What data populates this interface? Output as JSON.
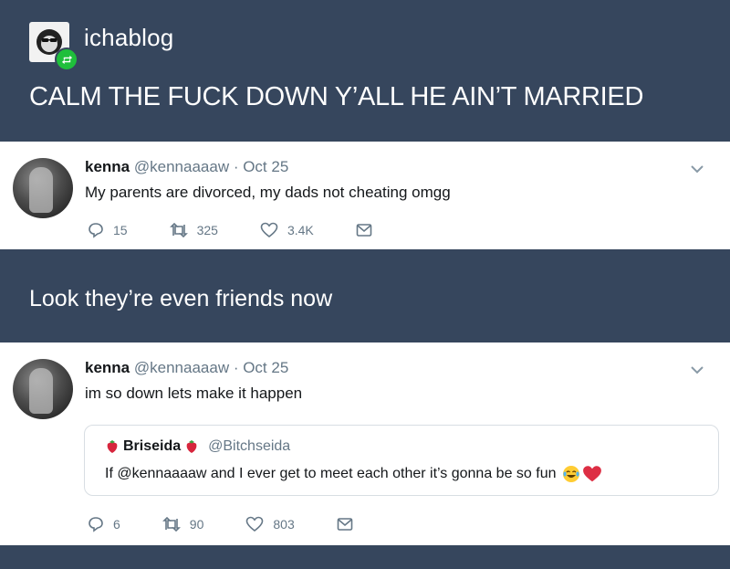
{
  "header": {
    "blog_name": "ichablog",
    "title": "CALM THE FUCK DOWN Y’ALL HE AIN’T MARRIED"
  },
  "tweet1": {
    "name": "kenna",
    "handle": "@kennaaaaw",
    "date": "· Oct 25",
    "text": "My parents are divorced, my dads not cheating omgg",
    "replies": "15",
    "retweets": "325",
    "likes": "3.4K"
  },
  "caption": "Look they’re even friends now",
  "tweet2": {
    "name": "kenna",
    "handle": "@kennaaaaw",
    "date": "· Oct 25",
    "text": "im so down lets make it happen",
    "quote": {
      "name": "Briseida",
      "handle": "@Bitchseida",
      "text": "If @kennaaaaw and I ever get to meet each other it’s gonna be so fun"
    },
    "replies": "6",
    "retweets": "90",
    "likes": "803"
  },
  "icons": {
    "accent_green": "#1fbf3b",
    "dashboard_bg": "#36465d",
    "muted_gray": "#657786"
  }
}
